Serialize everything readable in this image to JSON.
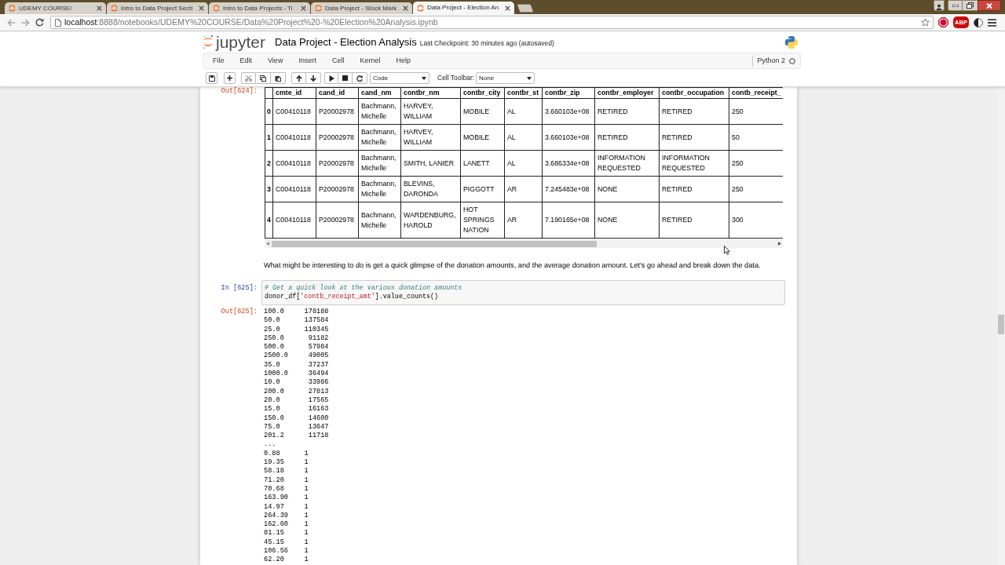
{
  "browser": {
    "tabs": [
      {
        "title": "UDEMY COURSE/",
        "selected": false
      },
      {
        "title": "Intro to Data Project Secti",
        "selected": false
      },
      {
        "title": "Intro to Data Projects - Ti",
        "selected": false
      },
      {
        "title": "Data Project - Stock Mark",
        "selected": false
      },
      {
        "title": "Data Project - Election An",
        "selected": true
      }
    ],
    "address": {
      "host": "localhost",
      "path": ":8888/notebooks/UDEMY%20COURSE/Data%20Project%20-%20Election%20Analysis.ipynb"
    },
    "adblock_badge": "ABP"
  },
  "notebook": {
    "logo": "jupyter",
    "title": "Data Project - Election Analysis",
    "checkpoint": "Last Checkpoint: 30 minutes ago (autosaved)",
    "menu": [
      "File",
      "Edit",
      "View",
      "Insert",
      "Cell",
      "Kernel",
      "Help"
    ],
    "kernel": "Python 2",
    "kernel_busy": false,
    "toolbar": {
      "cell_type": "Code",
      "cell_toolbar_label": "Cell Toolbar:",
      "cell_toolbar": "None"
    }
  },
  "cells": [
    {
      "kind": "table_output",
      "prompt": "Out[624]:",
      "columns": [
        "cmte_id",
        "cand_id",
        "cand_nm",
        "contbr_nm",
        "contbr_city",
        "contbr_st",
        "contbr_zip",
        "contbr_employer",
        "contbr_occupation",
        "contb_receipt_"
      ],
      "rows": [
        {
          "index": "0",
          "cells": [
            "C00410118",
            "P20002978",
            "Bachmann, Michelle",
            "HARVEY, WILLIAM",
            "MOBILE",
            "AL",
            "3.660103e+08",
            "RETIRED",
            "RETIRED",
            "250"
          ]
        },
        {
          "index": "1",
          "cells": [
            "C00410118",
            "P20002978",
            "Bachmann, Michelle",
            "HARVEY, WILLIAM",
            "MOBILE",
            "AL",
            "3.660103e+08",
            "RETIRED",
            "RETIRED",
            "50"
          ]
        },
        {
          "index": "2",
          "cells": [
            "C00410118",
            "P20002978",
            "Bachmann, Michelle",
            "SMITH, LANIER",
            "LANETT",
            "AL",
            "3.686334e+08",
            "INFORMATION REQUESTED",
            "INFORMATION REQUESTED",
            "250"
          ]
        },
        {
          "index": "3",
          "cells": [
            "C00410118",
            "P20002978",
            "Bachmann, Michelle",
            "BLEVINS, DARONDA",
            "PIGGOTT",
            "AR",
            "7.245483e+08",
            "NONE",
            "RETIRED",
            "250"
          ]
        },
        {
          "index": "4",
          "cells": [
            "C00410118",
            "P20002978",
            "Bachmann, Michelle",
            "WARDENBURG, HAROLD",
            "HOT SPRINGS NATION",
            "AR",
            "7.190165e+08",
            "NONE",
            "RETIRED",
            "300"
          ]
        }
      ]
    },
    {
      "kind": "markdown",
      "text": "What might be interesting to do is get a quick glimpse of the donation amounts, and the average donation amount. Let's go ahead and break down the data."
    },
    {
      "kind": "code",
      "prompt": "In [625]:",
      "lines": [
        [
          {
            "kind": "comment",
            "text": "# Get a quick look at the various donation amounts"
          }
        ],
        [
          {
            "kind": "plain",
            "text": "donor_df["
          },
          {
            "kind": "string",
            "text": "'contb_receipt_amt'"
          },
          {
            "kind": "plain",
            "text": "].value_counts()"
          }
        ]
      ]
    },
    {
      "kind": "text_output",
      "prompt": "Out[625]:",
      "lines": [
        "100.0     178188",
        "50.0      137584",
        "25.0      110345",
        "250.0      91182",
        "500.0      57984",
        "2500.0     49005",
        "35.0       37237",
        "1000.0     36494",
        "10.0       33986",
        "200.0      27813",
        "20.0       17565",
        "15.0       16163",
        "150.0      14600",
        "75.0       13647",
        "201.2      11718",
        "...",
        "0.88      1",
        "19.35     1",
        "58.18     1",
        "71.20     1",
        "70.68     1",
        "163.90    1",
        "14.97     1",
        "264.39    1",
        "162.60    1",
        "81.15     1",
        "45.15     1",
        "106.56    1",
        "62.20     1"
      ]
    }
  ]
}
